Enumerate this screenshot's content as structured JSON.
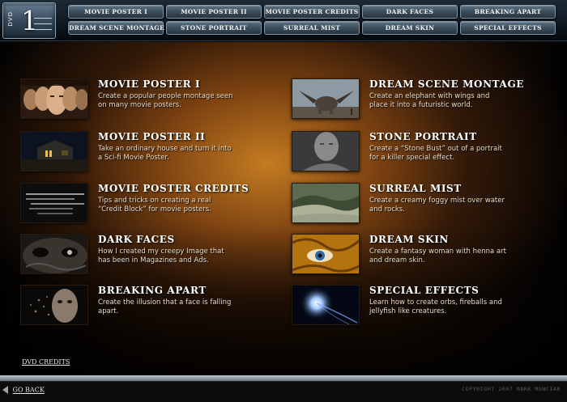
{
  "header": {
    "dvd_label": "DVD",
    "dvd_number": "1",
    "nav": [
      "Movie Poster I",
      "Movie Poster II",
      "Movie Poster Credits",
      "Dark Faces",
      "Breaking Apart",
      "Dream Scene Montage",
      "Stone Portrait",
      "Surreal Mist",
      "Dream Skin",
      "Special Effects"
    ]
  },
  "tutorials": {
    "left": [
      {
        "title": "Movie Poster I",
        "desc": "Create a popular people montage seen on many movie posters.",
        "icon": "faces-montage-thumbnail"
      },
      {
        "title": "Movie Poster II",
        "desc": "Take an ordinary house and turn it into a Sci-fi Movie Poster.",
        "icon": "house-at-night-thumbnail"
      },
      {
        "title": "Movie Poster Credits",
        "desc": "Tips and tricks on creating a real “Credit Block” for movie posters.",
        "icon": "credit-block-thumbnail"
      },
      {
        "title": "Dark Faces",
        "desc": "How I created my creepy Image that has been in Magazines and Ads.",
        "icon": "dark-face-thumbnail"
      },
      {
        "title": "Breaking Apart",
        "desc": "Create the illusion that a face is falling apart.",
        "icon": "breaking-face-thumbnail"
      }
    ],
    "right": [
      {
        "title": "Dream Scene Montage",
        "desc": "Create an elephant with wings and place it into a futuristic world.",
        "icon": "winged-elephant-thumbnail"
      },
      {
        "title": "Stone Portrait",
        "desc": "Create a “Stone Bust” out of a portrait for a killer special effect.",
        "icon": "stone-bust-thumbnail"
      },
      {
        "title": "Surreal Mist",
        "desc": "Create a creamy foggy mist over water and rocks.",
        "icon": "misty-landscape-thumbnail"
      },
      {
        "title": "Dream Skin",
        "desc": "Create a fantasy woman with henna art and dream skin.",
        "icon": "henna-eye-thumbnail"
      },
      {
        "title": "Special Effects",
        "desc": "Learn how to create orbs, fireballs and jellyfish like creatures.",
        "icon": "glowing-orb-thumbnail"
      }
    ]
  },
  "footer": {
    "dvd_credits": "DVD Credits",
    "go_back": "Go Back",
    "copyright": "Copyright 2007 Mark Monciar",
    "progress": 1.0
  }
}
